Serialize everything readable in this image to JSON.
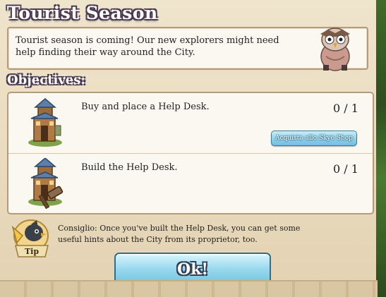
{
  "dialog": {
    "title": "Tourist Season",
    "intro": "Tourist season is coming! Our new explorers might need help finding their way around the City."
  },
  "objectives": {
    "header": "Objectives:",
    "items": [
      {
        "text": "Buy and place a Help Desk.",
        "progress": "0 / 1",
        "icon": "help-desk-building-icon",
        "action_label": "Acquista allo Skye Shop"
      },
      {
        "text": "Build the Help Desk.",
        "progress": "0 / 1",
        "icon": "help-desk-build-hammer-icon"
      }
    ]
  },
  "tip": {
    "badge_label": "Tip",
    "text": "Consiglio: Once you've built the Help Desk, you can get some useful hints about the City from its proprietor, too."
  },
  "ok_button": {
    "label": "Ok!"
  },
  "colors": {
    "title_outline": "#4b3a52",
    "button_blue": "#8fd2ec",
    "panel_bg": "#efe4cc",
    "box_border": "#b59b77"
  }
}
